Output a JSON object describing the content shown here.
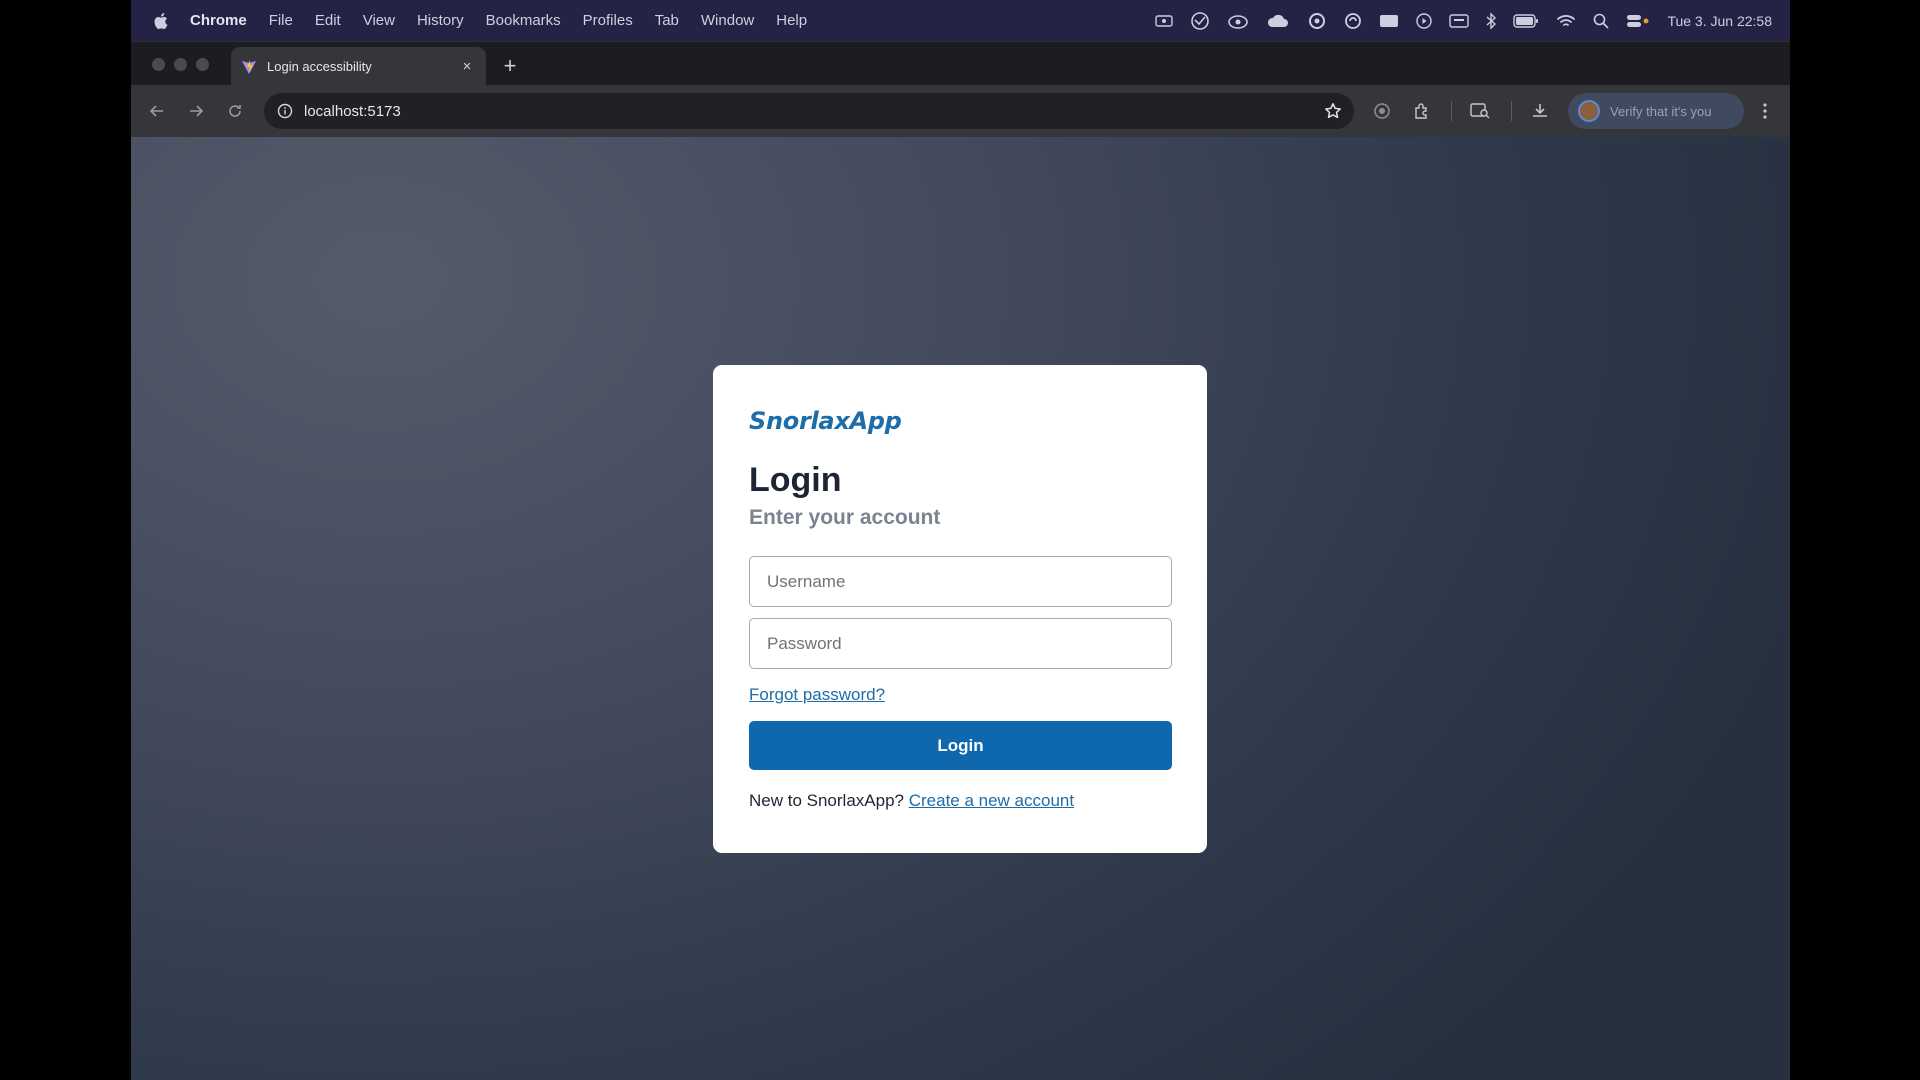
{
  "menubar": {
    "app_name": "Chrome",
    "items": [
      "File",
      "Edit",
      "View",
      "History",
      "Bookmarks",
      "Profiles",
      "Tab",
      "Window",
      "Help"
    ],
    "clock": "Tue 3. Jun  22:58"
  },
  "browser": {
    "tab_title": "Login accessibility",
    "tab_close": "×",
    "new_tab": "+",
    "url": "localhost:5173",
    "verify_label": "Verify that it's you"
  },
  "page": {
    "brand": "SnorlaxApp",
    "title": "Login",
    "subtitle": "Enter your account",
    "username_placeholder": "Username",
    "password_placeholder": "Password",
    "forgot_password": "Forgot password?",
    "login_button": "Login",
    "signup_prompt": "New to SnorlaxApp?",
    "signup_link": "Create a new account"
  },
  "colors": {
    "brand": "#1f6da8",
    "button": "#0f67ae",
    "menubar": "#252345"
  }
}
